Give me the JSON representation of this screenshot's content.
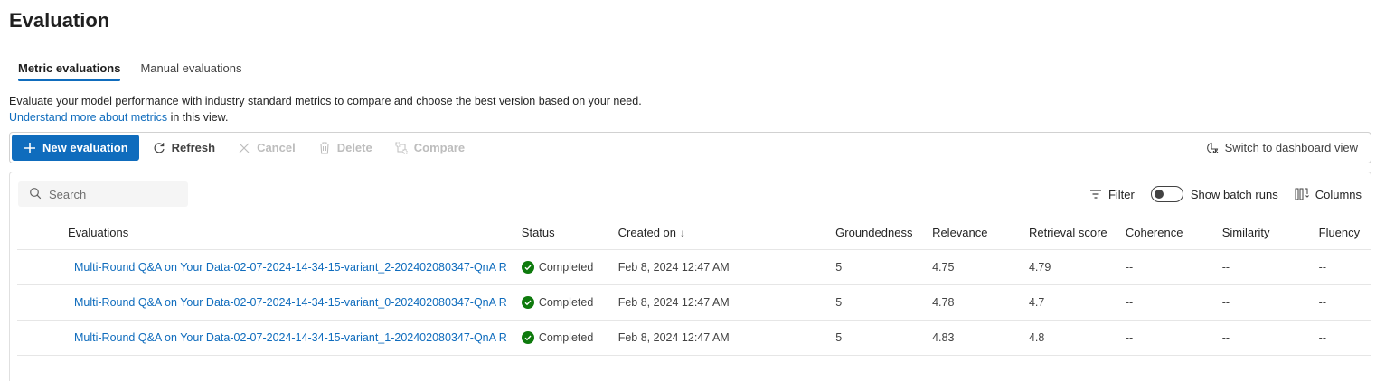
{
  "page": {
    "title": "Evaluation"
  },
  "tabs": [
    {
      "label": "Metric evaluations",
      "active": true
    },
    {
      "label": "Manual evaluations",
      "active": false
    }
  ],
  "description": {
    "line1": "Evaluate your model performance with industry standard metrics to compare and choose the best version based on your need.",
    "link": "Understand more about metrics",
    "suffix": " in this view."
  },
  "toolbar": {
    "new_evaluation": "New evaluation",
    "refresh": "Refresh",
    "cancel": "Cancel",
    "delete": "Delete",
    "compare": "Compare",
    "switch_view": "Switch to dashboard view"
  },
  "grid_tools": {
    "search_placeholder": "Search",
    "filter": "Filter",
    "show_batch_runs": "Show batch runs",
    "columns": "Columns"
  },
  "table": {
    "headers": {
      "evaluations": "Evaluations",
      "status": "Status",
      "created_on": "Created on",
      "sort_indicator": "↓",
      "groundedness": "Groundedness",
      "relevance": "Relevance",
      "retrieval_score": "Retrieval score",
      "coherence": "Coherence",
      "similarity": "Similarity",
      "fluency": "Fluency"
    },
    "rows": [
      {
        "name": "Multi-Round Q&A on Your Data-02-07-2024-14-34-15-variant_2-202402080347-QnA R",
        "status": "Completed",
        "created_on": "Feb 8, 2024 12:47 AM",
        "groundedness": "5",
        "relevance": "4.75",
        "retrieval_score": "4.79",
        "coherence": "--",
        "similarity": "--",
        "fluency": "--"
      },
      {
        "name": "Multi-Round Q&A on Your Data-02-07-2024-14-34-15-variant_0-202402080347-QnA R",
        "status": "Completed",
        "created_on": "Feb 8, 2024 12:47 AM",
        "groundedness": "5",
        "relevance": "4.78",
        "retrieval_score": "4.7",
        "coherence": "--",
        "similarity": "--",
        "fluency": "--"
      },
      {
        "name": "Multi-Round Q&A on Your Data-02-07-2024-14-34-15-variant_1-202402080347-QnA R",
        "status": "Completed",
        "created_on": "Feb 8, 2024 12:47 AM",
        "groundedness": "5",
        "relevance": "4.83",
        "retrieval_score": "4.8",
        "coherence": "--",
        "similarity": "--",
        "fluency": "--"
      }
    ]
  },
  "colors": {
    "accent": "#0f6cbd",
    "success": "#0e7a0d"
  },
  "icons": [
    "plus-icon",
    "refresh-icon",
    "close-icon",
    "trash-icon",
    "compare-icon",
    "dashboard-icon",
    "search-icon",
    "filter-icon",
    "columns-icon",
    "check-circle-icon"
  ]
}
